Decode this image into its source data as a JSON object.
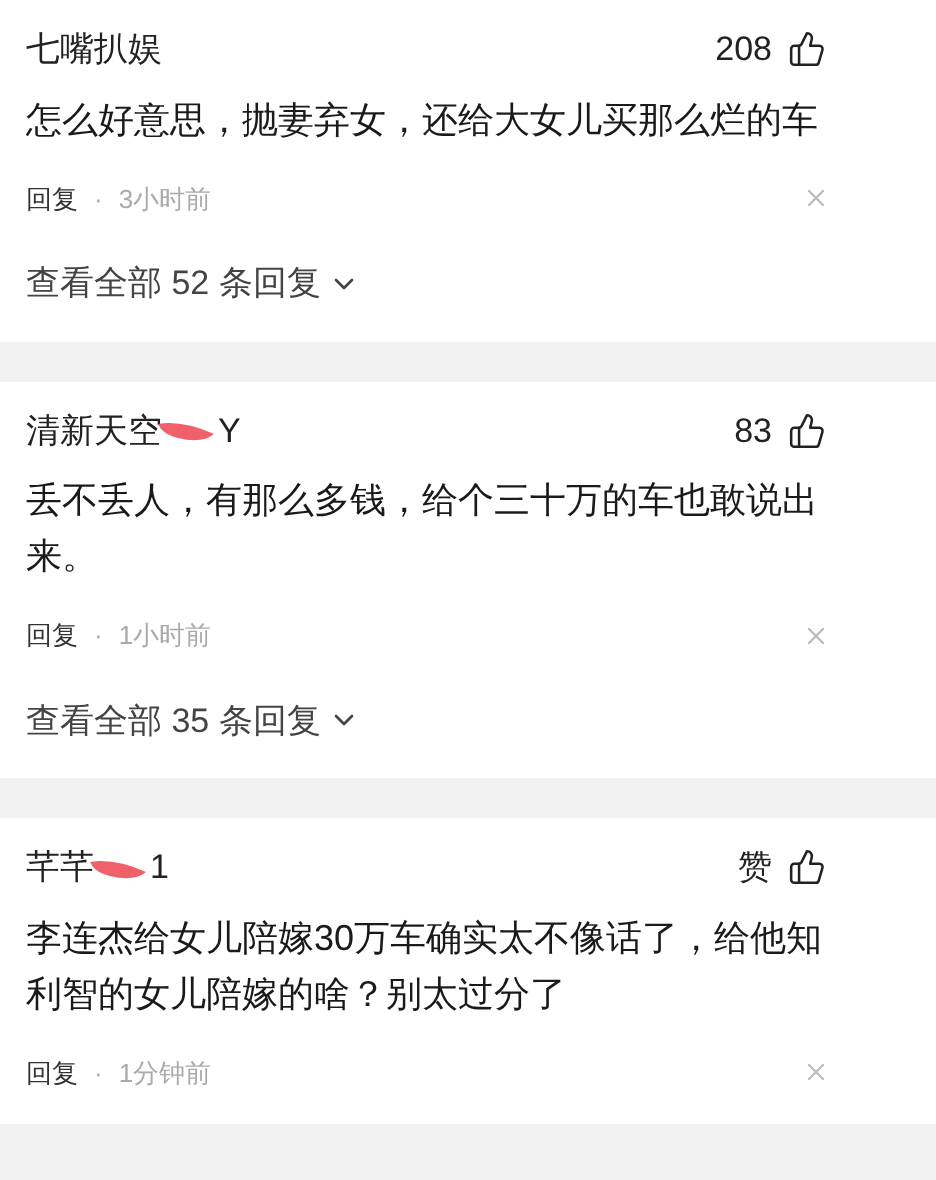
{
  "comments": [
    {
      "user": "七嘴扒娱",
      "redacted": false,
      "likes": "208",
      "text": "怎么好意思，抛妻弃女，还给大女儿买那么烂的车",
      "reply": "回复",
      "separator": "·",
      "time": "3小时前",
      "view_replies": "查看全部 52 条回复"
    },
    {
      "user": "清新天空",
      "user_suffix": "Y",
      "redacted": true,
      "likes": "83",
      "text": "丢不丢人，有那么多钱，给个三十万的车也敢说出来。",
      "reply": "回复",
      "separator": "·",
      "time": "1小时前",
      "view_replies": "查看全部 35 条回复"
    },
    {
      "user": "芊芊",
      "user_suffix": "1",
      "redacted": true,
      "likes": "赞",
      "text": "李连杰给女儿陪嫁30万车确实太不像话了，给他知利智的女儿陪嫁的啥？别太过分了",
      "reply": "回复",
      "separator": "·",
      "time": "1分钟前"
    }
  ]
}
